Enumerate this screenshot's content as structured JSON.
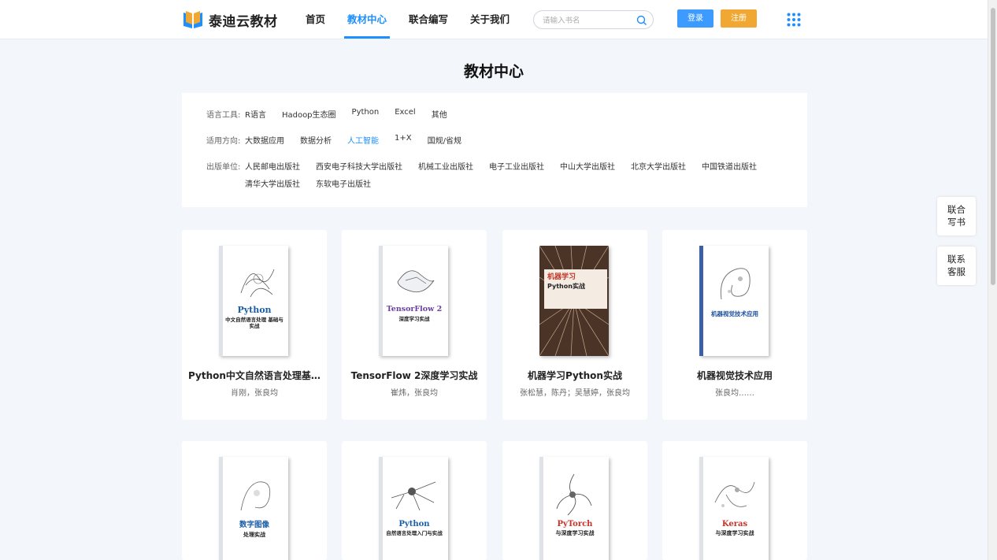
{
  "header": {
    "logo_text": "泰迪云教材",
    "nav": [
      "首页",
      "教材中心",
      "联合编写",
      "关于我们"
    ],
    "search_placeholder": "请输入书名",
    "login_label": "登录",
    "register_label": "注册"
  },
  "page_title": "教材中心",
  "filters": {
    "language": {
      "label": "语言工具:",
      "options": [
        "R语言",
        "Hadoop生态圈",
        "Python",
        "Excel",
        "其他"
      ]
    },
    "direction": {
      "label": "适用方向:",
      "options": [
        "大数据应用",
        "数据分析",
        "人工智能",
        "1+X",
        "国规/省规"
      ],
      "active": "人工智能"
    },
    "publisher": {
      "label": "出版单位:",
      "options": [
        "人民邮电出版社",
        "西安电子科技大学出版社",
        "机械工业出版社",
        "电子工业出版社",
        "中山大学出版社",
        "北京大学出版社",
        "中国铁道出版社",
        "清华大学出版社",
        "东软电子出版社"
      ]
    }
  },
  "books": [
    {
      "title": "Python中文自然语言处理基础与实战",
      "author": "肖刚，张良均",
      "cover_title": "Python",
      "cover_sub": "中文自然语言处理 基础与实战"
    },
    {
      "title": "TensorFlow 2深度学习实战",
      "author": "崔炜，张良均",
      "cover_title": "TensorFlow 2",
      "cover_sub": "深度学习实战"
    },
    {
      "title": "机器学习Python实战",
      "author": "张松慧，陈丹；吴慧婷，张良均",
      "cover_title": "机器学习",
      "cover_sub": "Python实战"
    },
    {
      "title": "机器视觉技术应用",
      "author": "张良均……",
      "cover_title": "",
      "cover_sub": "机器视觉技术应用"
    },
    {
      "title": "数字图像处理实战",
      "author": "",
      "cover_title": "数字图像",
      "cover_sub": "处理实战"
    },
    {
      "title": "Python自然语言处理入门与实战",
      "author": "",
      "cover_title": "Python",
      "cover_sub": "自然语言处理入门与实战"
    },
    {
      "title": "PyTorch与深度学习实战",
      "author": "",
      "cover_title": "PyTorch",
      "cover_sub": "与深度学习实战"
    },
    {
      "title": "Keras与深度学习实战",
      "author": "",
      "cover_title": "Keras",
      "cover_sub": "与深度学习实战"
    }
  ],
  "side": {
    "co_write": "联合写书",
    "contact": "联系客服"
  },
  "colors": {
    "accent": "#1e8fff",
    "login": "#3d9bff",
    "register": "#f0a832"
  }
}
